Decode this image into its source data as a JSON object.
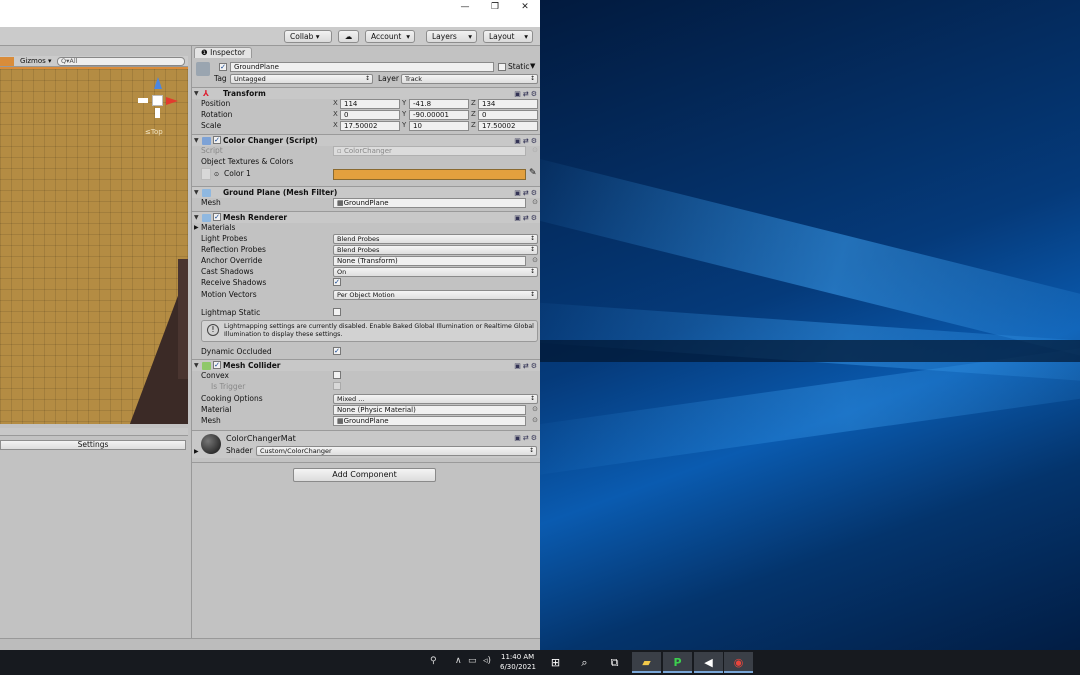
{
  "toolbar": {
    "collab": "Collab ▾",
    "account": "Account",
    "layers": "Layers",
    "layout": "Layout"
  },
  "window_controls": {
    "minimize": "—",
    "restore": "❐",
    "close": "✕"
  },
  "scene": {
    "gizmos": "Gizmos",
    "search_placeholder": "Q▾All",
    "orientation": "≤Top"
  },
  "lower_panel": {
    "settings_label": "Settings"
  },
  "inspector": {
    "tab": "Inspector",
    "object_name": "GroundPlane",
    "static_label": "Static",
    "tag_label": "Tag",
    "tag_value": "Untagged",
    "layer_label": "Layer",
    "layer_value": "Track",
    "transform": {
      "title": "Transform",
      "position_label": "Position",
      "position": [
        "114",
        "-41.8",
        "134"
      ],
      "rotation_label": "Rotation",
      "rotation": [
        "0",
        "-90.00001",
        "0"
      ],
      "scale_label": "Scale",
      "scale": [
        "17.50002",
        "10",
        "17.50002"
      ]
    },
    "color_changer": {
      "title": "Color Changer (Script)",
      "script_label": "Script",
      "script_value": "ColorChanger",
      "textures_label": "Object Textures & Colors",
      "color1_label": "Color 1",
      "color1_value": "#e3a03e"
    },
    "mesh_filter": {
      "title": "Ground Plane (Mesh Filter)",
      "mesh_label": "Mesh",
      "mesh_value": "GroundPlane"
    },
    "mesh_renderer": {
      "title": "Mesh Renderer",
      "materials_label": "Materials",
      "light_probes_label": "Light Probes",
      "light_probes": "Blend Probes",
      "reflection_label": "Reflection Probes",
      "reflection": "Blend Probes",
      "anchor_label": "Anchor Override",
      "anchor": "None (Transform)",
      "cast_label": "Cast Shadows",
      "cast": "On",
      "receive_label": "Receive Shadows",
      "motion_label": "Motion Vectors",
      "motion": "Per Object Motion",
      "lightmap_label": "Lightmap Static",
      "info_text_1": "Lightmapping settings are currently disabled. Enable Baked Global Illumination or Realtime Global",
      "info_text_2": "Illumination to display these settings.",
      "occluded_label": "Dynamic Occluded"
    },
    "mesh_collider": {
      "title": "Mesh Collider",
      "convex_label": "Convex",
      "trigger_label": "Is Trigger",
      "cooking_label": "Cooking Options",
      "cooking": "Mixed ...",
      "material_label": "Material",
      "material": "None (Physic Material)",
      "mesh_label": "Mesh",
      "mesh": "GroundPlane"
    },
    "material": {
      "name": "ColorChangerMat",
      "shader_label": "Shader",
      "shader": "Custom/ColorChanger"
    },
    "add_component": "Add Component"
  },
  "taskbar": {
    "time": "11:40 AM",
    "date": "6/30/2021"
  }
}
